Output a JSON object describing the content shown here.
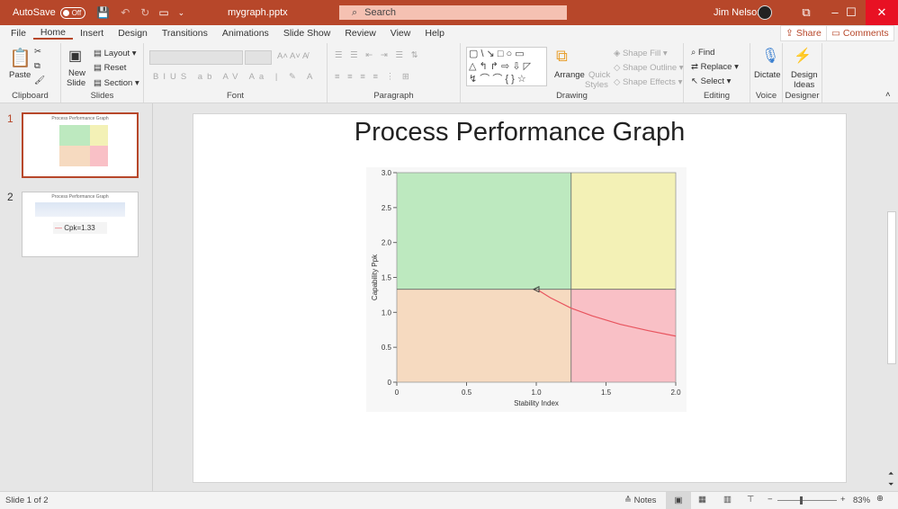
{
  "titlebar": {
    "autosave": "AutoSave",
    "autosave_state": "Off",
    "filename": "mygraph.pptx",
    "search_placeholder": "Search",
    "user": "Jim Nelson"
  },
  "tabs": [
    "File",
    "Home",
    "Insert",
    "Design",
    "Transitions",
    "Animations",
    "Slide Show",
    "Review",
    "View",
    "Help"
  ],
  "share": "Share",
  "comments": "Comments",
  "ribbon": {
    "clipboard": {
      "label": "Clipboard",
      "paste": "Paste"
    },
    "slides": {
      "label": "Slides",
      "new_slide": "New",
      "new_slide2": "Slide",
      "layout": "Layout",
      "reset": "Reset",
      "section": "Section"
    },
    "font": {
      "label": "Font"
    },
    "paragraph": {
      "label": "Paragraph"
    },
    "drawing": {
      "label": "Drawing",
      "arrange": "Arrange",
      "quick": "Quick",
      "styles": "Styles",
      "shape_fill": "Shape Fill",
      "shape_outline": "Shape Outline",
      "shape_effects": "Shape Effects"
    },
    "editing": {
      "label": "Editing",
      "find": "Find",
      "replace": "Replace",
      "select": "Select"
    },
    "voice": {
      "label": "Voice",
      "dictate": "Dictate"
    },
    "designer": {
      "label": "Designer",
      "design": "Design",
      "ideas": "Ideas"
    }
  },
  "thumbnails": [
    {
      "num": "1",
      "title": "Process Performance Graph"
    },
    {
      "num": "2",
      "title": "Process Performance Graph",
      "cpk": "Cpk=1.33"
    }
  ],
  "slide": {
    "title": "Process Performance Graph"
  },
  "chart_data": {
    "type": "line",
    "xlabel": "Stability Index",
    "ylabel": "Capability Ppk",
    "xlim": [
      0,
      2
    ],
    "ylim": [
      0,
      3
    ],
    "xticks": [
      "0",
      "0.5",
      "1.0",
      "1.5",
      "2.0"
    ],
    "yticks": [
      "0",
      "0.5",
      "1.0",
      "1.5",
      "2.0",
      "2.5",
      "3.0"
    ],
    "x_threshold": 1.25,
    "y_threshold": 1.33,
    "quadrants": {
      "top_left": "#bde9bf",
      "top_right": "#f3f1b6",
      "bottom_left": "#f6dac0",
      "bottom_right": "#f9c0c6"
    },
    "series": [
      {
        "name": "Cpk=1.33",
        "color": "#e8545e",
        "x": [
          1.02,
          1.1,
          1.25,
          1.4,
          1.6,
          1.8,
          2.0
        ],
        "y": [
          1.31,
          1.21,
          1.06,
          0.95,
          0.83,
          0.74,
          0.66
        ]
      }
    ],
    "marker": {
      "x": 1.0,
      "y": 1.33,
      "shape": "triangle-left"
    }
  },
  "status": {
    "slide": "Slide 1 of 2",
    "notes": "Notes",
    "zoom": "83%"
  }
}
